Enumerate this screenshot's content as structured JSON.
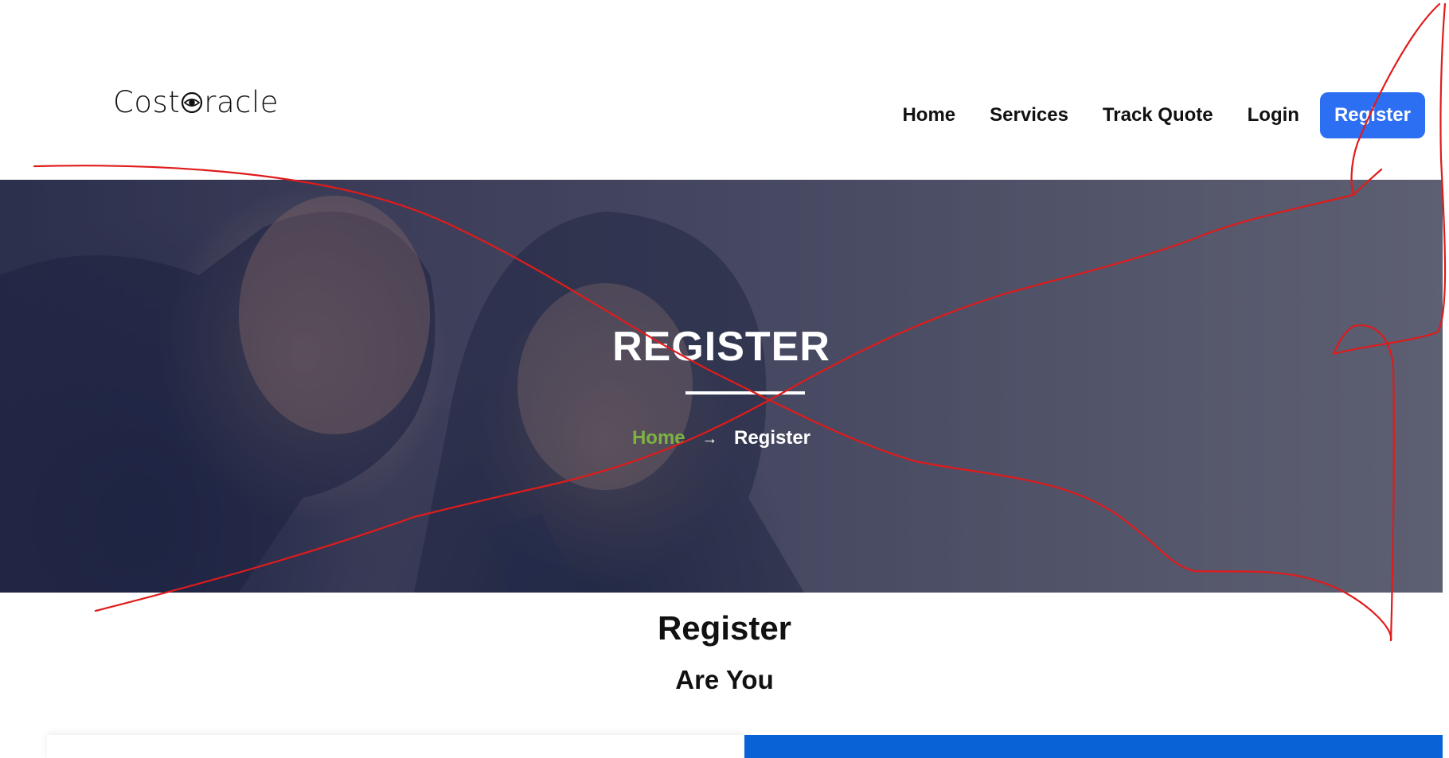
{
  "header": {
    "logo": {
      "prefix": "Cost",
      "suffix": "racle"
    },
    "nav": [
      {
        "label": "Home"
      },
      {
        "label": "Services"
      },
      {
        "label": "Track Quote"
      },
      {
        "label": "Login"
      }
    ],
    "register_button": "Register"
  },
  "hero": {
    "title": "REGISTER",
    "breadcrumb": {
      "home": "Home",
      "arrow": "→",
      "current": "Register"
    }
  },
  "main": {
    "title": "Register",
    "subtitle": "Are You"
  },
  "colors": {
    "primary": "#2d6ff2",
    "breadcrumb_home": "#7cb342",
    "card_blue": "#0a63d6",
    "annotation": "#e01b1b"
  }
}
